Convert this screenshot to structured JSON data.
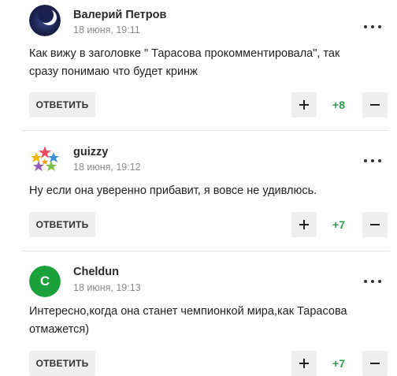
{
  "comments": [
    {
      "author": "Валерий Петров",
      "date": "18 июня, 19:11",
      "text_lines": [
        "Как вижу в заголовке \" Тарасова прокомментировала\", так",
        "сразу понимаю что будет кринж"
      ],
      "reply_label": "ОТВЕТИТЬ",
      "score": "+8",
      "avatar_icon": "moon-photo-icon"
    },
    {
      "author": "guizzy",
      "date": "18 июня, 19:12",
      "text_lines": [
        "Ну если она уверенно прибавит, я вовсе не удивлюсь."
      ],
      "reply_label": "ОТВЕТИТЬ",
      "score": "+7",
      "avatar_icon": "colorful-stars-icon"
    },
    {
      "author": "Cheldun",
      "date": "18 июня, 19:13",
      "text_lines": [
        "Интересно,когда она станет чемпионкой мира,как Тарасова",
        "отмажется)"
      ],
      "reply_label": "ОТВЕТИТЬ",
      "score": "+7",
      "avatar_letter": "C",
      "avatar_color": "#1aa13c"
    }
  ],
  "colors": {
    "score": "#2e9c4a",
    "button_bg": "#efefef"
  }
}
